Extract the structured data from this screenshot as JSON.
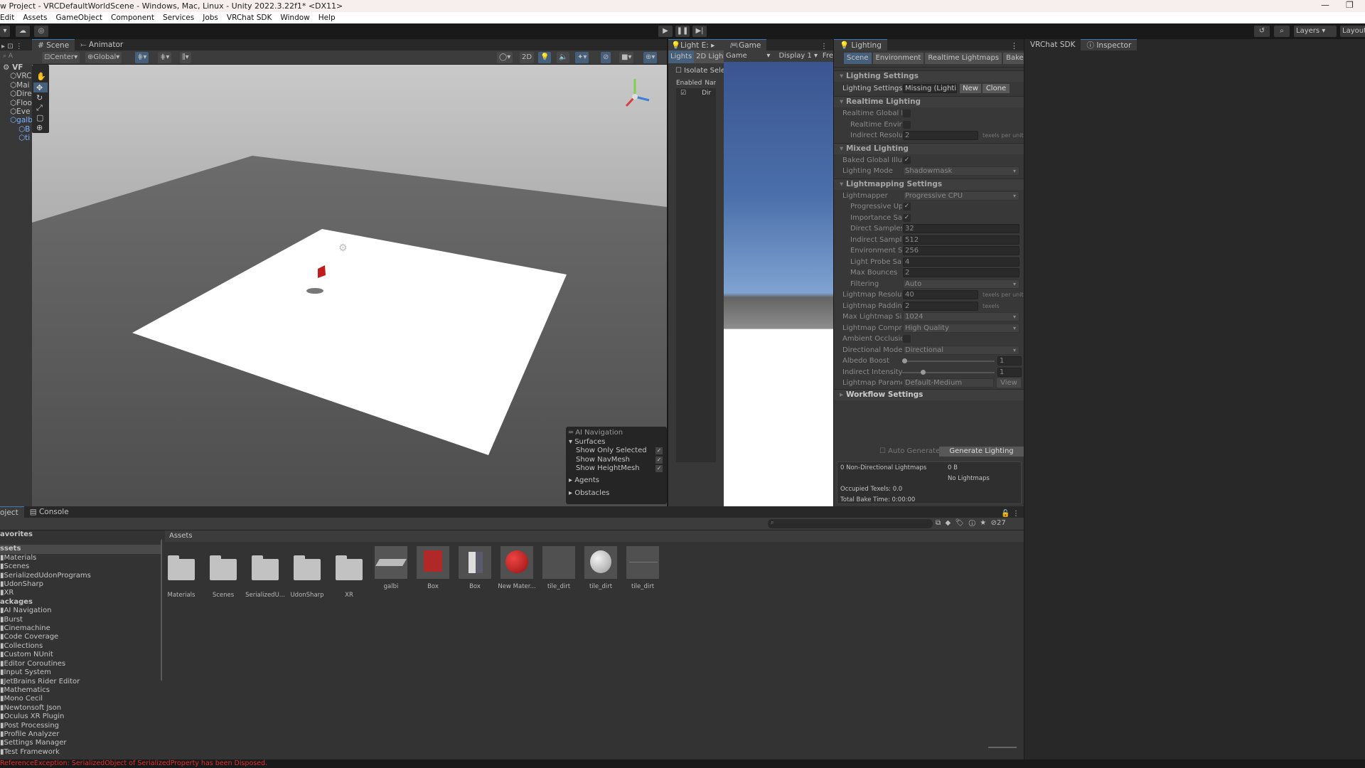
{
  "window": {
    "title": "w Project - VRCDefaultWorldScene - Windows, Mac, Linux - Unity 2022.3.22f1* <DX11>",
    "minimize": "—",
    "restore": "❐"
  },
  "menu": [
    "Edit",
    "Assets",
    "GameObject",
    "Component",
    "Services",
    "Jobs",
    "VRChat SDK",
    "Window",
    "Help"
  ],
  "toolbar": {
    "layers": "Layers",
    "layout": "Layout"
  },
  "hierarchy": {
    "root": "VF",
    "items": [
      "VRC",
      "Mai",
      "Dire",
      "Floo",
      "Eve",
      "galbi",
      "B",
      "ti"
    ]
  },
  "scene": {
    "tabs": [
      "Scene",
      "Animator"
    ],
    "pivot": "Center",
    "space": "Global",
    "mode_2d": "2D"
  },
  "ai_navigation": {
    "title": "AI Navigation",
    "surfaces": "Surfaces",
    "options": [
      {
        "label": "Show Only Selected",
        "checked": true
      },
      {
        "label": "Show NavMesh",
        "checked": true
      },
      {
        "label": "Show HeightMesh",
        "checked": true
      }
    ],
    "agents": "Agents",
    "obstacles": "Obstacles"
  },
  "light_explorer": {
    "tab": "Light E:",
    "subtabs": [
      "Lights",
      "2D Lights"
    ],
    "isolate": "Isolate Selec",
    "columns": [
      "Enabled",
      "Nar"
    ],
    "row": {
      "enabled": true,
      "name": "Dir"
    }
  },
  "game": {
    "tab": "Game",
    "mode": "Game",
    "display": "Display 1",
    "aspect": "Fre"
  },
  "lighting": {
    "tab": "Lighting",
    "subtabs": [
      "Scene",
      "Environment",
      "Realtime Lightmaps",
      "Baked Lightm"
    ],
    "rows": [
      {
        "t": "sec",
        "label": "Lighting Settings"
      },
      {
        "t": "asset",
        "label": "Lighting Settings A",
        "value": "Missing (Lighting",
        "b1": "New",
        "b2": "Clone"
      },
      {
        "t": "sec",
        "label": "Realtime Lighting"
      },
      {
        "t": "chk",
        "label": "Realtime Global Illu",
        "checked": false
      },
      {
        "t": "chk",
        "label": "Realtime Enviror",
        "checked": false,
        "indent": true
      },
      {
        "t": "num",
        "label": "Indirect Resoluti",
        "value": "2",
        "unit": "texels per unit",
        "indent": true
      },
      {
        "t": "sec",
        "label": "Mixed Lighting"
      },
      {
        "t": "chk",
        "label": "Baked Global Illum",
        "checked": true
      },
      {
        "t": "drop",
        "label": "Lighting Mode",
        "value": "Shadowmask"
      },
      {
        "t": "sec",
        "label": "Lightmapping Settings"
      },
      {
        "t": "drop",
        "label": "Lightmapper",
        "value": "Progressive CPU"
      },
      {
        "t": "chk",
        "label": "Progressive Upc",
        "checked": true,
        "indent": true
      },
      {
        "t": "chk",
        "label": "Importance Sam",
        "checked": true,
        "indent": true
      },
      {
        "t": "wide",
        "label": "Direct Samples",
        "value": "32",
        "indent": true
      },
      {
        "t": "wide",
        "label": "Indirect Sample:",
        "value": "512",
        "indent": true
      },
      {
        "t": "wide",
        "label": "Environment Sa",
        "value": "256",
        "indent": true
      },
      {
        "t": "wide",
        "label": "Light Probe Sam",
        "value": "4",
        "indent": true
      },
      {
        "t": "wide",
        "label": "Max Bounces",
        "value": "2",
        "indent": true
      },
      {
        "t": "drop",
        "label": "Filtering",
        "value": "Auto",
        "indent": true
      },
      {
        "t": "num",
        "label": "Lightmap Resolutic",
        "value": "40",
        "unit": "texels per unit"
      },
      {
        "t": "num",
        "label": "Lightmap Padding",
        "value": "2",
        "unit": "texels"
      },
      {
        "t": "drop",
        "label": "Max Lightmap Size",
        "value": "1024"
      },
      {
        "t": "drop",
        "label": "Lightmap Compres",
        "value": "High Quality"
      },
      {
        "t": "chk",
        "label": "Ambient Occlusion",
        "checked": false
      },
      {
        "t": "drop",
        "label": "Directional Mode",
        "value": "Directional"
      },
      {
        "t": "slider",
        "label": "Albedo Boost",
        "value": "1",
        "level": 0
      },
      {
        "t": "slider",
        "label": "Indirect Intensity",
        "value": "1",
        "level": 0.2
      },
      {
        "t": "param",
        "label": "Lightmap Paramet",
        "value": "Default-Medium",
        "b1": "View"
      },
      {
        "t": "sec",
        "label": "Workflow Settings",
        "collapsed": true
      }
    ],
    "auto_generate": "Auto Generate",
    "generate": "Generate Lighting",
    "stats": {
      "lightmaps": "0 Non-Directional Lightmaps",
      "size": "0 B",
      "none": "No Lightmaps",
      "texels": "Occupied Texels: 0.0",
      "bake_time": "Total Bake Time: 0:00:00"
    }
  },
  "right": {
    "tabs": [
      "VRChat SDK",
      "Inspector"
    ]
  },
  "project": {
    "tabs": [
      "oject",
      "Console"
    ],
    "favorites": "avorites",
    "assets_root": "ssets",
    "assets": [
      "Materials",
      "Scenes",
      "SerializedUdonPrograms",
      "UdonSharp",
      "XR"
    ],
    "packages_root": "ackages",
    "packages": [
      "AI Navigation",
      "Burst",
      "Cinemachine",
      "Code Coverage",
      "Collections",
      "Custom NUnit",
      "Editor Coroutines",
      "Input System",
      "JetBrains Rider Editor",
      "Mathematics",
      "Mono Cecil",
      "Newtonsoft Json",
      "Oculus XR Plugin",
      "Post Processing",
      "Profile Analyzer",
      "Settings Manager",
      "Test Framework"
    ],
    "breadcrumb": "Assets",
    "hidden_count": "27",
    "grid": [
      {
        "name": "Materials",
        "kind": "folder"
      },
      {
        "name": "Scenes",
        "kind": "folder"
      },
      {
        "name": "SerializedU...",
        "kind": "folder"
      },
      {
        "name": "UdonSharp",
        "kind": "folder"
      },
      {
        "name": "XR",
        "kind": "folder"
      },
      {
        "name": "galbi",
        "kind": "prefab"
      },
      {
        "name": "Box",
        "kind": "cube"
      },
      {
        "name": "Box",
        "kind": "mesh"
      },
      {
        "name": "New Mater...",
        "kind": "red-sphere"
      },
      {
        "name": "tile_dirt",
        "kind": "blank"
      },
      {
        "name": "tile_dirt",
        "kind": "white-sphere"
      },
      {
        "name": "tile_dirt",
        "kind": "line"
      }
    ]
  },
  "status": {
    "error": "ReferenceException: SerializedObject of SerializedProperty has been Disposed.",
    "color": "#e03030"
  }
}
